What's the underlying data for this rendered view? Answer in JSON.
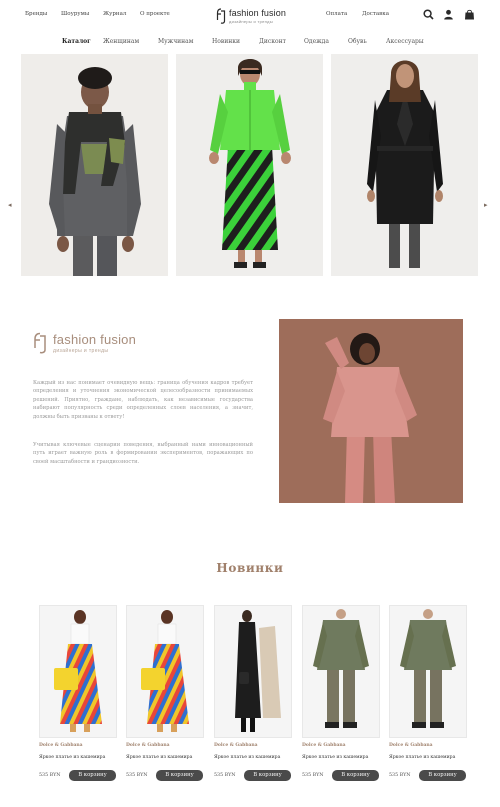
{
  "header": {
    "left_nav": [
      "Бренды",
      "Шоурумы",
      "Журнал",
      "О проекте"
    ],
    "logo": {
      "name": "fashion fusion",
      "tagline": "дизайнеры и тренды"
    },
    "right_nav": [
      "Оплата",
      "Доставка"
    ],
    "icons": [
      "search-icon",
      "user-icon",
      "bag-icon"
    ]
  },
  "categories": {
    "items": [
      "Каталог",
      "Женщинам",
      "Мужчинам",
      "Новинки",
      "Дисконт",
      "Одежда",
      "Обувь",
      "Аксессуары"
    ],
    "active": "Каталог"
  },
  "carousel": {
    "prev": "◂",
    "next": "▸",
    "slides": [
      "man-scarf-photo",
      "woman-green-jacket-photo",
      "woman-black-coat-photo"
    ]
  },
  "about": {
    "logo_name": "fashion fusion",
    "logo_tag": "дизайнеры и тренды",
    "paragraph1": "Каждый из нас понимает очевидную вещь: граница обучения кадров требует определения и уточнения экономической целесообразности принимаемых решений. Приятно, граждане, наблюдать, как независимые государства набирают популярность среди определенных слоев населения, а значит, должны быть призваны к ответу!",
    "paragraph2": "Учитывая ключевые сценарии поведения, выбранный нами инновационный путь играет важную роль в формировании экспериментов, поражающих по своей масштабности и грандиозности."
  },
  "new_arrivals": {
    "title": "Новинки",
    "products": [
      {
        "brand": "Dolce & Gabbana",
        "name": "Яркое платье из кашемира",
        "price": "535 BYN",
        "button": "В корзину"
      },
      {
        "brand": "Dolce & Gabbana",
        "name": "Яркое платье из кашемира",
        "price": "535 BYN",
        "button": "В корзину"
      },
      {
        "brand": "Dolce & Gabbana",
        "name": "Яркое платье из кашемира",
        "price": "535 BYN",
        "button": "В корзину"
      },
      {
        "brand": "Dolce & Gabbana",
        "name": "Яркое платье из кашемира",
        "price": "535 BYN",
        "button": "В корзину"
      },
      {
        "brand": "Dolce & Gabbana",
        "name": "Яркое платье из кашемира",
        "price": "535 BYN",
        "button": "В корзину"
      }
    ]
  },
  "colors": {
    "accent": "#a0806b",
    "button": "#4a4a4a"
  }
}
